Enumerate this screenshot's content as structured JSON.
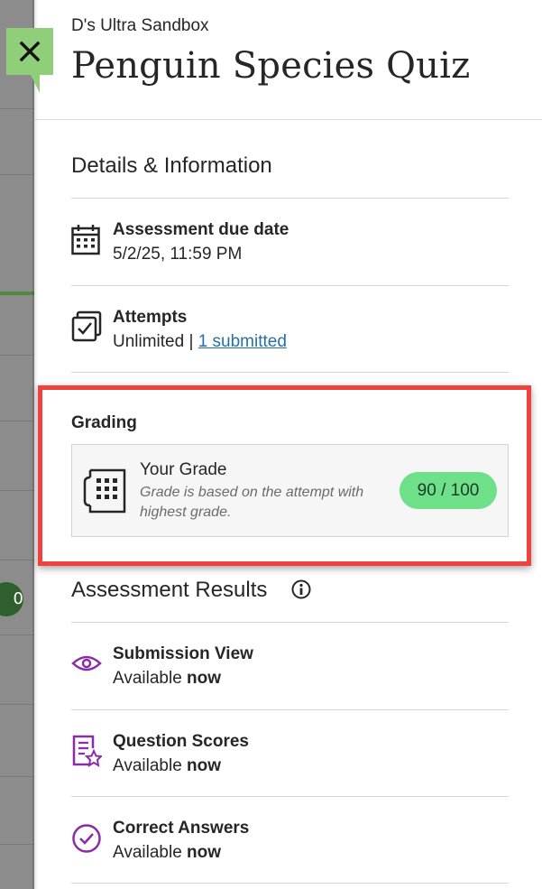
{
  "background": {
    "pill_text": "0"
  },
  "header": {
    "course_name": "D's Ultra Sandbox",
    "title": "Penguin Species Quiz",
    "close_icon": "close-icon"
  },
  "details": {
    "title": "Details & Information",
    "due": {
      "icon": "calendar-icon",
      "label": "Assessment due date",
      "value": "5/2/25, 11:59 PM"
    },
    "attempts": {
      "icon": "attempts-icon",
      "label": "Attempts",
      "value": "Unlimited",
      "separator": "|",
      "link": "1 submitted"
    }
  },
  "grading": {
    "title": "Grading",
    "card": {
      "icon": "grade-sheet-icon",
      "title": "Your Grade",
      "note": "Grade is based on the attempt with highest grade.",
      "score": "90 / 100",
      "score_color": "#6ee08a"
    },
    "highlight_color": "#f0413f"
  },
  "results": {
    "title": "Assessment Results",
    "info_icon": "info-icon",
    "items": [
      {
        "icon": "eye-icon",
        "label": "Submission View",
        "prefix": "Available",
        "status": "now"
      },
      {
        "icon": "question-scores-icon",
        "label": "Question Scores",
        "prefix": "Available",
        "status": "now"
      },
      {
        "icon": "check-circle-icon",
        "label": "Correct Answers",
        "prefix": "Available",
        "status": "now"
      }
    ],
    "accent_color": "#8a2da6"
  }
}
